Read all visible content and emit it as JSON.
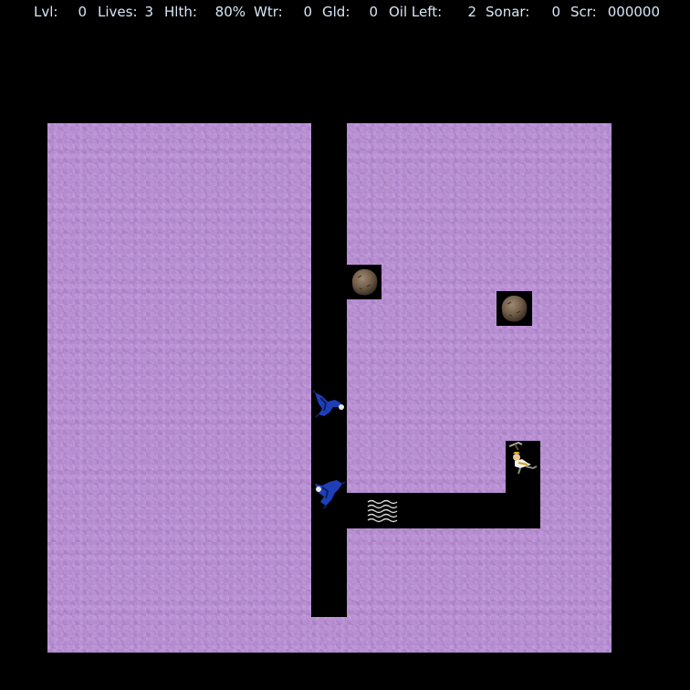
{
  "hud": {
    "level_label": "Lvl:",
    "level_value": "0",
    "lives_label": "Lives:",
    "lives_value": "3",
    "health_label": "Hlth:",
    "health_value": "80%",
    "water_label": "Wtr:",
    "water_value": "0",
    "gold_label": "Gld:",
    "gold_value": "0",
    "oil_label": "Oil Left:",
    "oil_value": "2",
    "sonar_label": "Sonar:",
    "sonar_value": "0",
    "score_label": "Scr:",
    "score_value": "000000"
  },
  "colors": {
    "background": "#000000",
    "earth": "#b98fd4",
    "hud_text": "#d8e6f6",
    "protester_blue": "#1f3fb8",
    "boulder_brown": "#6e5a46"
  },
  "icons": {
    "boulder": "boulder-icon",
    "protester": "protester-icon",
    "digger": "tunnelman-icon",
    "water_pool": "water-pool-icon"
  }
}
